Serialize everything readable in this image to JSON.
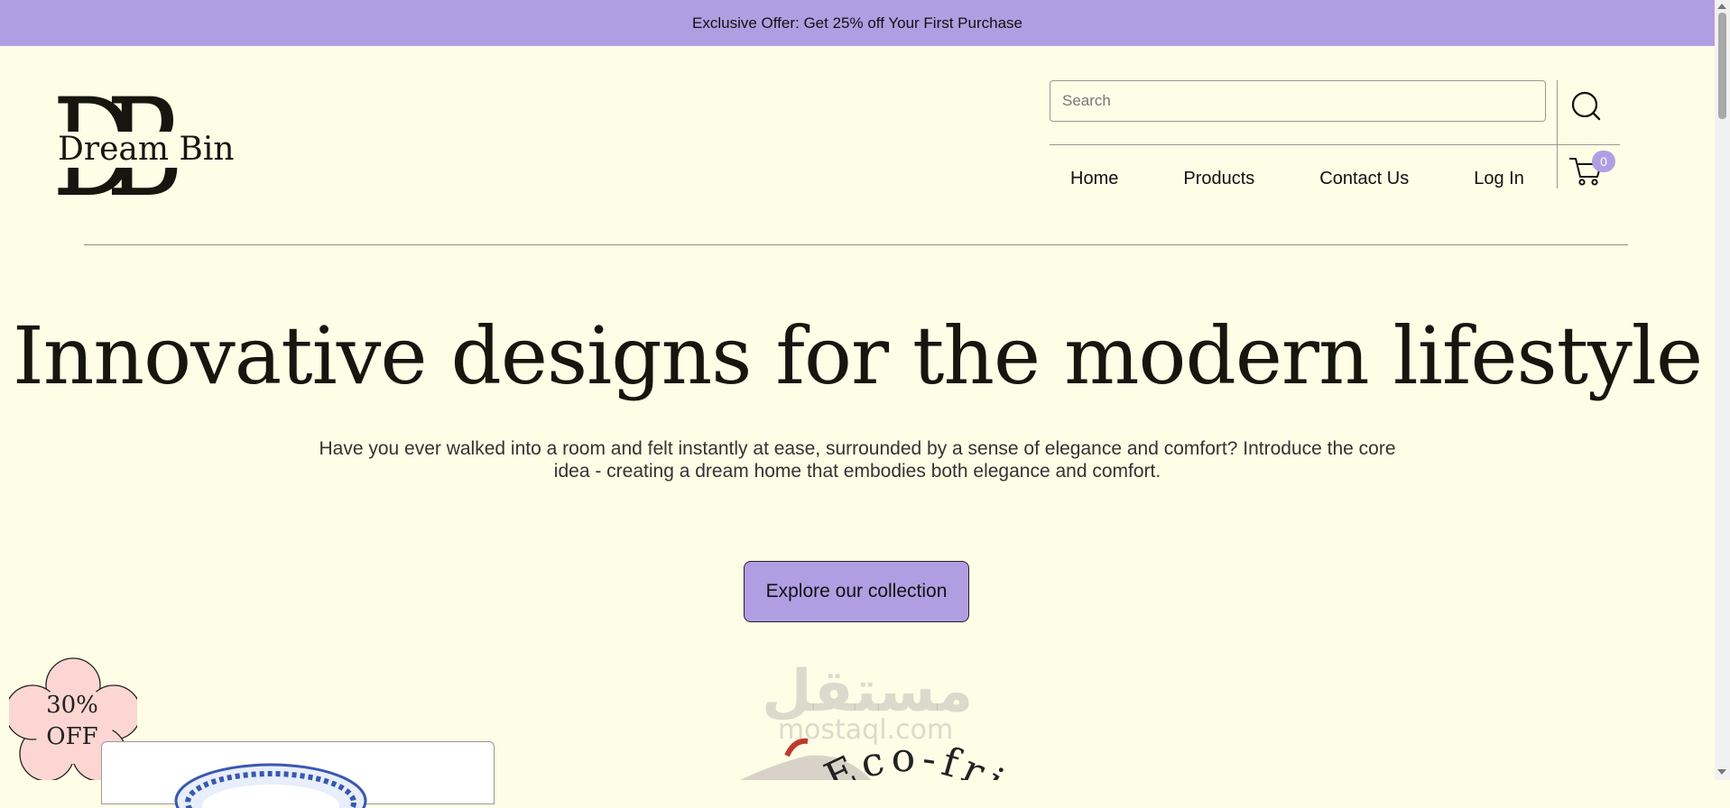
{
  "promo": {
    "text": "Exclusive Offer: Get 25% off Your First Purchase"
  },
  "logo": {
    "monogram": "DB",
    "brand_name": "Dream Bin"
  },
  "search": {
    "placeholder": "Search",
    "value": ""
  },
  "nav": {
    "links": [
      {
        "label": "Home"
      },
      {
        "label": "Products"
      },
      {
        "label": "Contact Us"
      },
      {
        "label": "Log In"
      }
    ],
    "cart_count": "0"
  },
  "hero": {
    "title": "Innovative designs for the modern lifestyle",
    "subtitle": "Have you ever walked into a room and felt instantly at ease, surrounded by a sense of elegance and comfort? Introduce the core idea - creating a dream home that embodies both elegance and comfort.",
    "cta_label": "Explore our collection"
  },
  "sale_badge": {
    "line1": "30%",
    "line2": "OFF"
  },
  "eco_badge": {
    "text": "Eco-friend"
  },
  "watermark": {
    "arabic": "مستقل",
    "latin": "mostaql.com"
  },
  "colors": {
    "background": "#fefde6",
    "accent": "#b19ee2",
    "sale_flower": "#fbd6d3",
    "text": "#16160f"
  },
  "icons": [
    "search-icon",
    "cart-icon",
    "scroll-up-icon",
    "scroll-down-icon"
  ]
}
